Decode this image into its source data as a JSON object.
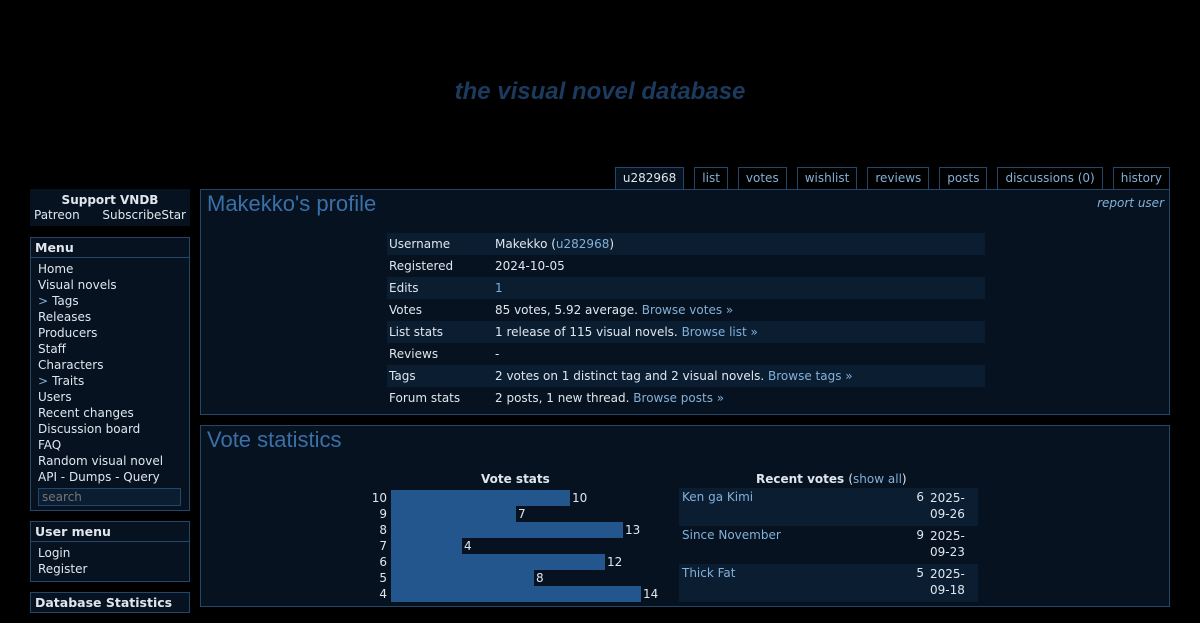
{
  "site_title": "the visual novel database",
  "tabs": [
    "u282968",
    "list",
    "votes",
    "wishlist",
    "reviews",
    "posts",
    "discussions (0)",
    "history"
  ],
  "support": {
    "title": "Support VNDB",
    "patreon": "Patreon",
    "subscribestar": "SubscribeStar"
  },
  "menu": {
    "title": "Menu",
    "items": [
      "Home",
      "Visual novels",
      "Tags",
      "Releases",
      "Producers",
      "Staff",
      "Characters",
      "Traits",
      "Users",
      "Recent changes",
      "Discussion board",
      "FAQ",
      "Random visual novel",
      "API - Dumps - Query"
    ],
    "search_placeholder": "search"
  },
  "user_menu": {
    "title": "User menu",
    "items": [
      "Login",
      "Register"
    ]
  },
  "db_stats": {
    "title": "Database Statistics"
  },
  "profile": {
    "title": "Makekko's profile",
    "report": "report user",
    "rows": {
      "username_k": "Username",
      "username_v": "Makekko (",
      "username_link": "u282968",
      "username_close": ")",
      "registered_k": "Registered",
      "registered_v": "2024-10-05",
      "edits_k": "Edits",
      "edits_v": "1",
      "votes_k": "Votes",
      "votes_v": "85 votes, 5.92 average.",
      "votes_link": "Browse votes »",
      "list_k": "List stats",
      "list_v": "1 release of 115 visual novels.",
      "list_link": "Browse list »",
      "reviews_k": "Reviews",
      "reviews_v": "-",
      "tags_k": "Tags",
      "tags_v": "2 votes on 1 distinct tag and 2 visual novels.",
      "tags_link": "Browse tags »",
      "forum_k": "Forum stats",
      "forum_v": "2 posts, 1 new thread.",
      "forum_link": "Browse posts »"
    }
  },
  "vote_stats": {
    "title": "Vote statistics",
    "chart_title": "Vote stats",
    "recent_title": "Recent votes",
    "show_all": "show all",
    "recent": [
      {
        "title": "Ken ga Kimi",
        "score": "6",
        "date_a": "2025-",
        "date_b": "09-26"
      },
      {
        "title": "Since November",
        "score": "9",
        "date_a": "2025-",
        "date_b": "09-23"
      },
      {
        "title": "Thick Fat",
        "score": "5",
        "date_a": "2025-",
        "date_b": "09-18"
      }
    ]
  },
  "chart_data": {
    "type": "bar",
    "title": "Vote stats",
    "categories": [
      "10",
      "9",
      "8",
      "7",
      "6",
      "5",
      "4"
    ],
    "values": [
      10,
      7,
      13,
      4,
      12,
      8,
      14
    ],
    "max": 14
  }
}
